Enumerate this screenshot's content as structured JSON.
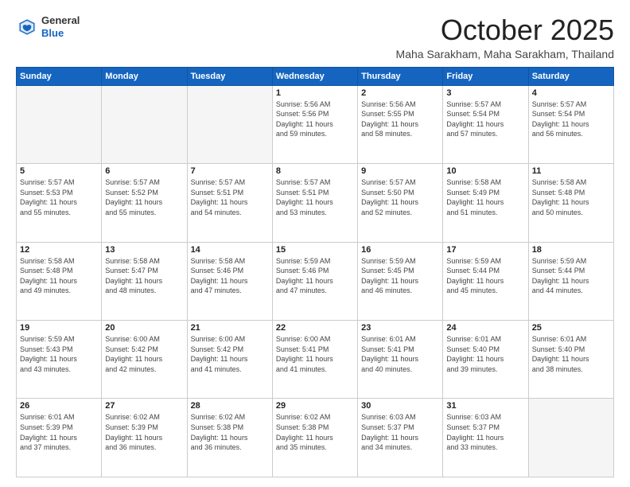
{
  "logo": {
    "general": "General",
    "blue": "Blue"
  },
  "header": {
    "month": "October 2025",
    "location": "Maha Sarakham, Maha Sarakham, Thailand"
  },
  "weekdays": [
    "Sunday",
    "Monday",
    "Tuesday",
    "Wednesday",
    "Thursday",
    "Friday",
    "Saturday"
  ],
  "weeks": [
    [
      {
        "day": "",
        "info": ""
      },
      {
        "day": "",
        "info": ""
      },
      {
        "day": "",
        "info": ""
      },
      {
        "day": "1",
        "info": "Sunrise: 5:56 AM\nSunset: 5:56 PM\nDaylight: 11 hours\nand 59 minutes."
      },
      {
        "day": "2",
        "info": "Sunrise: 5:56 AM\nSunset: 5:55 PM\nDaylight: 11 hours\nand 58 minutes."
      },
      {
        "day": "3",
        "info": "Sunrise: 5:57 AM\nSunset: 5:54 PM\nDaylight: 11 hours\nand 57 minutes."
      },
      {
        "day": "4",
        "info": "Sunrise: 5:57 AM\nSunset: 5:54 PM\nDaylight: 11 hours\nand 56 minutes."
      }
    ],
    [
      {
        "day": "5",
        "info": "Sunrise: 5:57 AM\nSunset: 5:53 PM\nDaylight: 11 hours\nand 55 minutes."
      },
      {
        "day": "6",
        "info": "Sunrise: 5:57 AM\nSunset: 5:52 PM\nDaylight: 11 hours\nand 55 minutes."
      },
      {
        "day": "7",
        "info": "Sunrise: 5:57 AM\nSunset: 5:51 PM\nDaylight: 11 hours\nand 54 minutes."
      },
      {
        "day": "8",
        "info": "Sunrise: 5:57 AM\nSunset: 5:51 PM\nDaylight: 11 hours\nand 53 minutes."
      },
      {
        "day": "9",
        "info": "Sunrise: 5:57 AM\nSunset: 5:50 PM\nDaylight: 11 hours\nand 52 minutes."
      },
      {
        "day": "10",
        "info": "Sunrise: 5:58 AM\nSunset: 5:49 PM\nDaylight: 11 hours\nand 51 minutes."
      },
      {
        "day": "11",
        "info": "Sunrise: 5:58 AM\nSunset: 5:48 PM\nDaylight: 11 hours\nand 50 minutes."
      }
    ],
    [
      {
        "day": "12",
        "info": "Sunrise: 5:58 AM\nSunset: 5:48 PM\nDaylight: 11 hours\nand 49 minutes."
      },
      {
        "day": "13",
        "info": "Sunrise: 5:58 AM\nSunset: 5:47 PM\nDaylight: 11 hours\nand 48 minutes."
      },
      {
        "day": "14",
        "info": "Sunrise: 5:58 AM\nSunset: 5:46 PM\nDaylight: 11 hours\nand 47 minutes."
      },
      {
        "day": "15",
        "info": "Sunrise: 5:59 AM\nSunset: 5:46 PM\nDaylight: 11 hours\nand 47 minutes."
      },
      {
        "day": "16",
        "info": "Sunrise: 5:59 AM\nSunset: 5:45 PM\nDaylight: 11 hours\nand 46 minutes."
      },
      {
        "day": "17",
        "info": "Sunrise: 5:59 AM\nSunset: 5:44 PM\nDaylight: 11 hours\nand 45 minutes."
      },
      {
        "day": "18",
        "info": "Sunrise: 5:59 AM\nSunset: 5:44 PM\nDaylight: 11 hours\nand 44 minutes."
      }
    ],
    [
      {
        "day": "19",
        "info": "Sunrise: 5:59 AM\nSunset: 5:43 PM\nDaylight: 11 hours\nand 43 minutes."
      },
      {
        "day": "20",
        "info": "Sunrise: 6:00 AM\nSunset: 5:42 PM\nDaylight: 11 hours\nand 42 minutes."
      },
      {
        "day": "21",
        "info": "Sunrise: 6:00 AM\nSunset: 5:42 PM\nDaylight: 11 hours\nand 41 minutes."
      },
      {
        "day": "22",
        "info": "Sunrise: 6:00 AM\nSunset: 5:41 PM\nDaylight: 11 hours\nand 41 minutes."
      },
      {
        "day": "23",
        "info": "Sunrise: 6:01 AM\nSunset: 5:41 PM\nDaylight: 11 hours\nand 40 minutes."
      },
      {
        "day": "24",
        "info": "Sunrise: 6:01 AM\nSunset: 5:40 PM\nDaylight: 11 hours\nand 39 minutes."
      },
      {
        "day": "25",
        "info": "Sunrise: 6:01 AM\nSunset: 5:40 PM\nDaylight: 11 hours\nand 38 minutes."
      }
    ],
    [
      {
        "day": "26",
        "info": "Sunrise: 6:01 AM\nSunset: 5:39 PM\nDaylight: 11 hours\nand 37 minutes."
      },
      {
        "day": "27",
        "info": "Sunrise: 6:02 AM\nSunset: 5:39 PM\nDaylight: 11 hours\nand 36 minutes."
      },
      {
        "day": "28",
        "info": "Sunrise: 6:02 AM\nSunset: 5:38 PM\nDaylight: 11 hours\nand 36 minutes."
      },
      {
        "day": "29",
        "info": "Sunrise: 6:02 AM\nSunset: 5:38 PM\nDaylight: 11 hours\nand 35 minutes."
      },
      {
        "day": "30",
        "info": "Sunrise: 6:03 AM\nSunset: 5:37 PM\nDaylight: 11 hours\nand 34 minutes."
      },
      {
        "day": "31",
        "info": "Sunrise: 6:03 AM\nSunset: 5:37 PM\nDaylight: 11 hours\nand 33 minutes."
      },
      {
        "day": "",
        "info": ""
      }
    ]
  ]
}
